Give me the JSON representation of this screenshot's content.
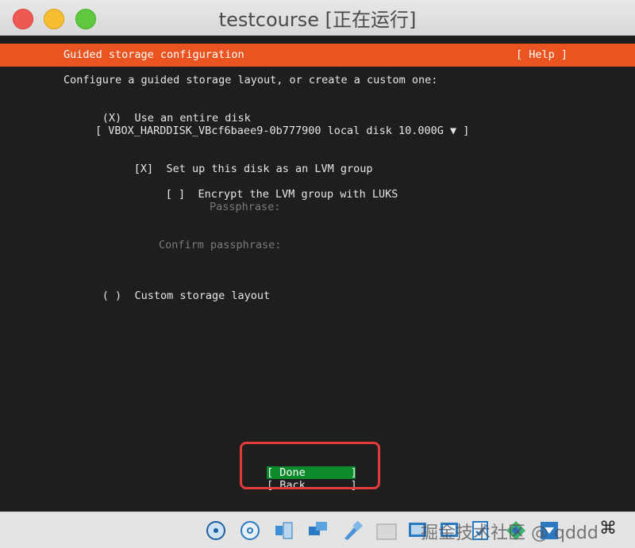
{
  "window": {
    "title": "testcourse [正在运行]"
  },
  "installer": {
    "header_title": "Guided storage configuration",
    "help_label": "[ Help ]",
    "intro": "Configure a guided storage layout, or create a custom one:",
    "use_entire_disk": {
      "marker": "(X)",
      "label": "Use an entire disk"
    },
    "disk_select": "[ VBOX_HARDDISK_VBcf6baee9-0b777900 local disk 10.000G ▼ ]",
    "lvm": {
      "marker": "[X]",
      "label": "Set up this disk as an LVM group"
    },
    "encrypt": {
      "marker": "[ ]",
      "label": "Encrypt the LVM group with LUKS"
    },
    "passphrase_label": "Passphrase:",
    "confirm_passphrase_label": "Confirm passphrase:",
    "custom_layout": {
      "marker": "( )",
      "label": "Custom storage layout"
    },
    "done_label": "[ Done       ]",
    "back_label": "[ Back       ]"
  },
  "statusbar": {
    "icons": [
      "hard-disk-icon",
      "optical-disk-icon",
      "audio-icon",
      "network-icon",
      "usb-icon",
      "shared-folder-icon",
      "display-icon",
      "recording-icon",
      "cpu-virtualization-icon",
      "mouse-integration-icon",
      "keyboard-capture-icon"
    ],
    "host_key": "⌘",
    "watermark": "掘金技术社区 @ qddd"
  },
  "colors": {
    "header": "#e95420",
    "done_button": "#0d8a2c",
    "highlight": "#e33b3b",
    "screen_bg": "#1e1e1e"
  }
}
